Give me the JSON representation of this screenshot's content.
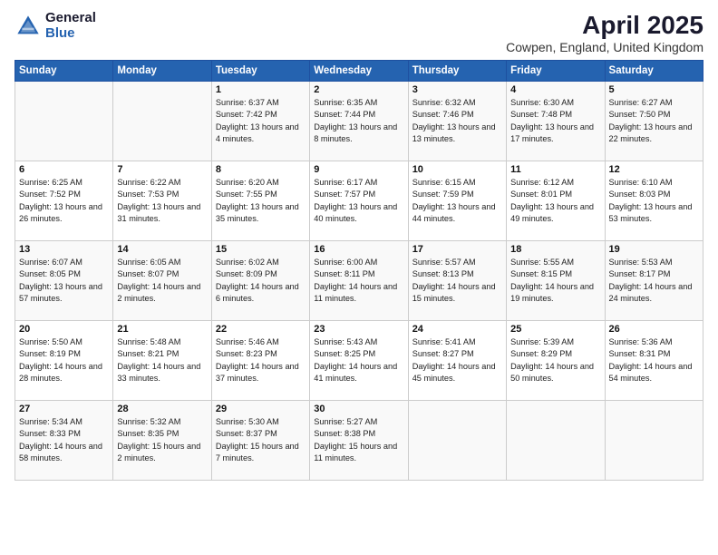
{
  "header": {
    "logo_general": "General",
    "logo_blue": "Blue",
    "title": "April 2025",
    "subtitle": "Cowpen, England, United Kingdom"
  },
  "days_of_week": [
    "Sunday",
    "Monday",
    "Tuesday",
    "Wednesday",
    "Thursday",
    "Friday",
    "Saturday"
  ],
  "weeks": [
    [
      {
        "day": "",
        "info": ""
      },
      {
        "day": "",
        "info": ""
      },
      {
        "day": "1",
        "info": "Sunrise: 6:37 AM\nSunset: 7:42 PM\nDaylight: 13 hours and 4 minutes."
      },
      {
        "day": "2",
        "info": "Sunrise: 6:35 AM\nSunset: 7:44 PM\nDaylight: 13 hours and 8 minutes."
      },
      {
        "day": "3",
        "info": "Sunrise: 6:32 AM\nSunset: 7:46 PM\nDaylight: 13 hours and 13 minutes."
      },
      {
        "day": "4",
        "info": "Sunrise: 6:30 AM\nSunset: 7:48 PM\nDaylight: 13 hours and 17 minutes."
      },
      {
        "day": "5",
        "info": "Sunrise: 6:27 AM\nSunset: 7:50 PM\nDaylight: 13 hours and 22 minutes."
      }
    ],
    [
      {
        "day": "6",
        "info": "Sunrise: 6:25 AM\nSunset: 7:52 PM\nDaylight: 13 hours and 26 minutes."
      },
      {
        "day": "7",
        "info": "Sunrise: 6:22 AM\nSunset: 7:53 PM\nDaylight: 13 hours and 31 minutes."
      },
      {
        "day": "8",
        "info": "Sunrise: 6:20 AM\nSunset: 7:55 PM\nDaylight: 13 hours and 35 minutes."
      },
      {
        "day": "9",
        "info": "Sunrise: 6:17 AM\nSunset: 7:57 PM\nDaylight: 13 hours and 40 minutes."
      },
      {
        "day": "10",
        "info": "Sunrise: 6:15 AM\nSunset: 7:59 PM\nDaylight: 13 hours and 44 minutes."
      },
      {
        "day": "11",
        "info": "Sunrise: 6:12 AM\nSunset: 8:01 PM\nDaylight: 13 hours and 49 minutes."
      },
      {
        "day": "12",
        "info": "Sunrise: 6:10 AM\nSunset: 8:03 PM\nDaylight: 13 hours and 53 minutes."
      }
    ],
    [
      {
        "day": "13",
        "info": "Sunrise: 6:07 AM\nSunset: 8:05 PM\nDaylight: 13 hours and 57 minutes."
      },
      {
        "day": "14",
        "info": "Sunrise: 6:05 AM\nSunset: 8:07 PM\nDaylight: 14 hours and 2 minutes."
      },
      {
        "day": "15",
        "info": "Sunrise: 6:02 AM\nSunset: 8:09 PM\nDaylight: 14 hours and 6 minutes."
      },
      {
        "day": "16",
        "info": "Sunrise: 6:00 AM\nSunset: 8:11 PM\nDaylight: 14 hours and 11 minutes."
      },
      {
        "day": "17",
        "info": "Sunrise: 5:57 AM\nSunset: 8:13 PM\nDaylight: 14 hours and 15 minutes."
      },
      {
        "day": "18",
        "info": "Sunrise: 5:55 AM\nSunset: 8:15 PM\nDaylight: 14 hours and 19 minutes."
      },
      {
        "day": "19",
        "info": "Sunrise: 5:53 AM\nSunset: 8:17 PM\nDaylight: 14 hours and 24 minutes."
      }
    ],
    [
      {
        "day": "20",
        "info": "Sunrise: 5:50 AM\nSunset: 8:19 PM\nDaylight: 14 hours and 28 minutes."
      },
      {
        "day": "21",
        "info": "Sunrise: 5:48 AM\nSunset: 8:21 PM\nDaylight: 14 hours and 33 minutes."
      },
      {
        "day": "22",
        "info": "Sunrise: 5:46 AM\nSunset: 8:23 PM\nDaylight: 14 hours and 37 minutes."
      },
      {
        "day": "23",
        "info": "Sunrise: 5:43 AM\nSunset: 8:25 PM\nDaylight: 14 hours and 41 minutes."
      },
      {
        "day": "24",
        "info": "Sunrise: 5:41 AM\nSunset: 8:27 PM\nDaylight: 14 hours and 45 minutes."
      },
      {
        "day": "25",
        "info": "Sunrise: 5:39 AM\nSunset: 8:29 PM\nDaylight: 14 hours and 50 minutes."
      },
      {
        "day": "26",
        "info": "Sunrise: 5:36 AM\nSunset: 8:31 PM\nDaylight: 14 hours and 54 minutes."
      }
    ],
    [
      {
        "day": "27",
        "info": "Sunrise: 5:34 AM\nSunset: 8:33 PM\nDaylight: 14 hours and 58 minutes."
      },
      {
        "day": "28",
        "info": "Sunrise: 5:32 AM\nSunset: 8:35 PM\nDaylight: 15 hours and 2 minutes."
      },
      {
        "day": "29",
        "info": "Sunrise: 5:30 AM\nSunset: 8:37 PM\nDaylight: 15 hours and 7 minutes."
      },
      {
        "day": "30",
        "info": "Sunrise: 5:27 AM\nSunset: 8:38 PM\nDaylight: 15 hours and 11 minutes."
      },
      {
        "day": "",
        "info": ""
      },
      {
        "day": "",
        "info": ""
      },
      {
        "day": "",
        "info": ""
      }
    ]
  ]
}
